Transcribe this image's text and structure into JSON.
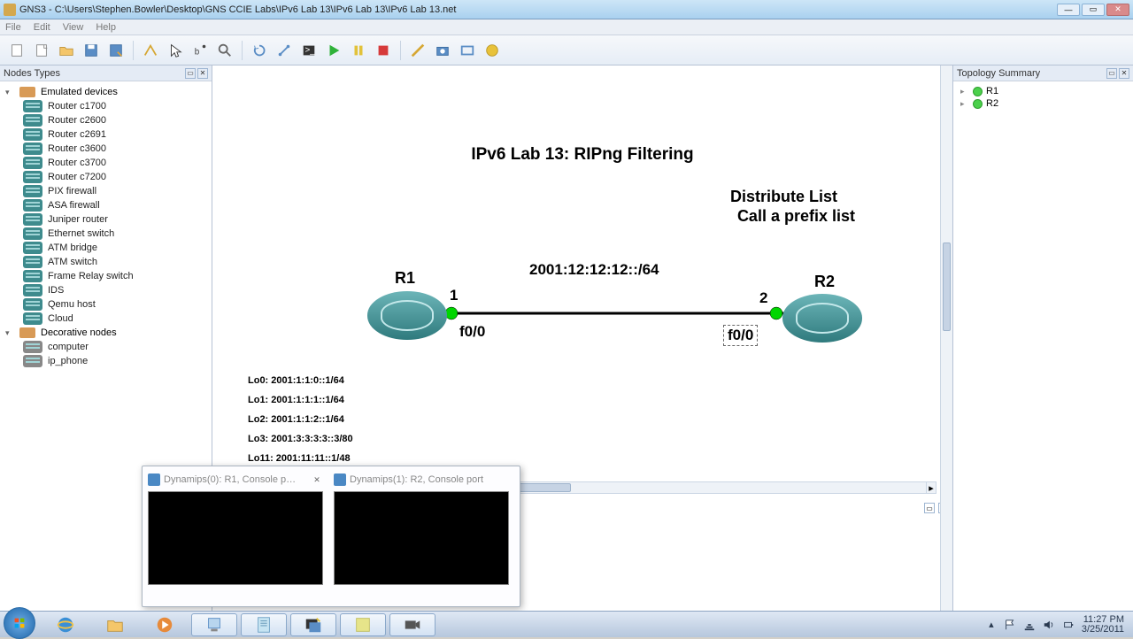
{
  "window": {
    "title": "GNS3 - C:\\Users\\Stephen.Bowler\\Desktop\\GNS CCIE Labs\\IPv6 Lab 13\\IPv6 Lab 13\\IPv6 Lab 13.net"
  },
  "menu": {
    "file": "File",
    "edit": "Edit",
    "view": "View",
    "help": "Help"
  },
  "panels": {
    "left_title": "Nodes Types",
    "right_title": "Topology Summary"
  },
  "nodes": {
    "emulated_label": "Emulated devices",
    "emulated": [
      "Router c1700",
      "Router c2600",
      "Router c2691",
      "Router c3600",
      "Router c3700",
      "Router c7200",
      "PIX firewall",
      "ASA firewall",
      "Juniper router",
      "Ethernet switch",
      "ATM bridge",
      "ATM switch",
      "Frame Relay switch",
      "IDS",
      "Qemu host",
      "Cloud"
    ],
    "decorative_label": "Decorative nodes",
    "decorative": [
      "computer",
      "ip_phone"
    ]
  },
  "topology": {
    "title": "IPv6 Lab 13: RIPng Filtering",
    "annot1": "Distribute List",
    "annot2": "Call a prefix list",
    "r1": "R1",
    "r2": "R2",
    "port1": "1",
    "port2": "2",
    "if1": "f0/0",
    "if2": "f0/0",
    "subnet": "2001:12:12:12::/64",
    "loopbacks": [
      "Lo0: 2001:1:1:0::1/64",
      "Lo1: 2001:1:1:1::1/64",
      "Lo2: 2001:1:1:2::1/64",
      "Lo3: 2001:3:3:3:3::3/80",
      "Lo11: 2001:11:11::1/48"
    ]
  },
  "summary": {
    "items": [
      "R1",
      "R2"
    ]
  },
  "preview": {
    "t1": "Dynamips(0): R1, Console p…",
    "t2": "Dynamips(1): R2, Console port"
  },
  "tray": {
    "time": "11:27 PM",
    "date": "3/25/2011"
  }
}
